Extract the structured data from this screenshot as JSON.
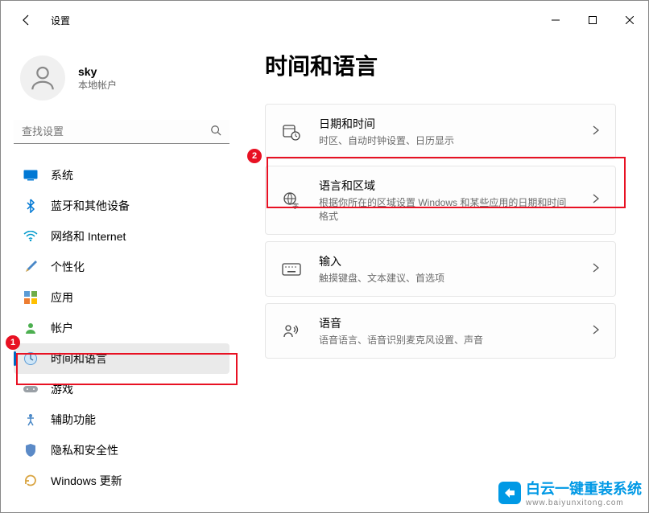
{
  "app": {
    "title": "设置"
  },
  "user": {
    "name": "sky",
    "subtitle": "本地帐户"
  },
  "search": {
    "placeholder": "查找设置"
  },
  "sidebar": {
    "items": [
      {
        "label": "系统"
      },
      {
        "label": "蓝牙和其他设备"
      },
      {
        "label": "网络和 Internet"
      },
      {
        "label": "个性化"
      },
      {
        "label": "应用"
      },
      {
        "label": "帐户"
      },
      {
        "label": "时间和语言"
      },
      {
        "label": "游戏"
      },
      {
        "label": "辅助功能"
      },
      {
        "label": "隐私和安全性"
      },
      {
        "label": "Windows 更新"
      }
    ]
  },
  "page": {
    "title": "时间和语言"
  },
  "cards": [
    {
      "title": "日期和时间",
      "subtitle": "时区、自动时钟设置、日历显示"
    },
    {
      "title": "语言和区域",
      "subtitle": "根据你所在的区域设置 Windows 和某些应用的日期和时间格式"
    },
    {
      "title": "输入",
      "subtitle": "触摸键盘、文本建议、首选项"
    },
    {
      "title": "语音",
      "subtitle": "语音语言、语音识别麦克风设置、声音"
    }
  ],
  "annotations": {
    "badge1": "1",
    "badge2": "2"
  },
  "watermark": {
    "title": "白云一键重装系统",
    "url": "www.baiyunxitong.com"
  }
}
